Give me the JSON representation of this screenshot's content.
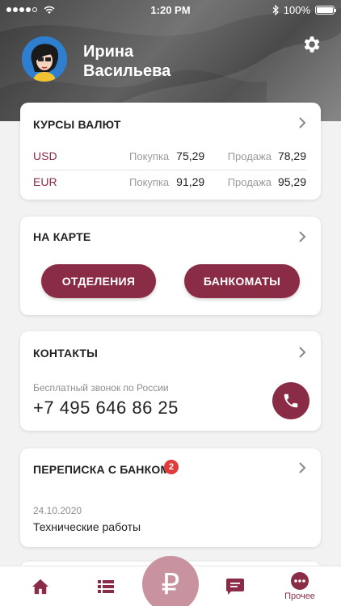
{
  "status_bar": {
    "time": "1:20 PM",
    "battery": "100%"
  },
  "profile": {
    "first_name": "Ирина",
    "last_name": "Васильева"
  },
  "rates": {
    "title": "КУРСЫ ВАЛЮТ",
    "buy_label": "Покупка",
    "sell_label": "Продажа",
    "rows": [
      {
        "currency": "USD",
        "buy": "75,29",
        "sell": "78,29"
      },
      {
        "currency": "EUR",
        "buy": "91,29",
        "sell": "95,29"
      }
    ]
  },
  "map": {
    "title": "НА КАРТЕ",
    "branches_label": "ОТДЕЛЕНИЯ",
    "atms_label": "БАНКОМАТЫ"
  },
  "contacts": {
    "title": "КОНТАКТЫ",
    "subtitle": "Бесплатный звонок по России",
    "phone": "+7 495 646 86 25"
  },
  "messages": {
    "title": "ПЕРЕПИСКА С БАНКОМ",
    "badge": "2",
    "date": "24.10.2020",
    "text": "Технические работы"
  },
  "tabbar": {
    "more_label": "Прочее",
    "ruble_symbol": "₽"
  },
  "colors": {
    "accent": "#8b2c47",
    "fab": "#c9929f",
    "badge": "#e03a3a"
  }
}
